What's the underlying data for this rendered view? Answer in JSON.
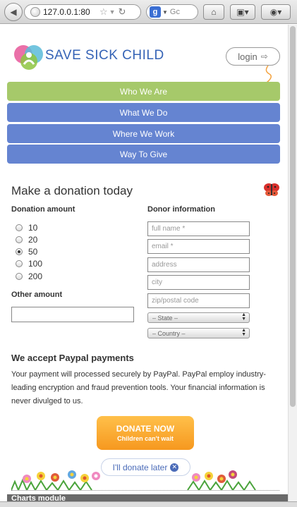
{
  "browser": {
    "url": "127.0.0.1:80",
    "search_text": "Gc",
    "search_engine_letter": "g"
  },
  "header": {
    "logo_text": "SAVE SICK CHILD",
    "login_label": "login"
  },
  "nav": {
    "items": [
      {
        "label": "Who We Are"
      },
      {
        "label": "What We Do"
      },
      {
        "label": "Where We Work"
      },
      {
        "label": "Way To Give"
      }
    ],
    "colors": {
      "active": "#a6c96a",
      "default": "#6584d1"
    }
  },
  "donation": {
    "title": "Make a donation today",
    "amount_label": "Donation amount",
    "amounts": [
      "10",
      "20",
      "50",
      "100",
      "200"
    ],
    "selected_amount": "50",
    "other_amount_label": "Other amount",
    "donor_label": "Donor information",
    "fields": {
      "full_name": "full name *",
      "email": "email *",
      "address": "address",
      "city": "city",
      "zip": "zip/postal code"
    },
    "state_select": "– State –",
    "country_select": "– Country –"
  },
  "paypal": {
    "heading": "We accept Paypal payments",
    "text": "Your payment will processed securely by PayPal. PayPal employ industry-leading encryption and fraud prevention tools. Your financial information is never divulged to us."
  },
  "cta": {
    "donate_label": "DONATE NOW",
    "donate_sub": "Children can't wait",
    "later_label": "I'll donate later",
    "button_color": "#f6981f"
  },
  "footer": {
    "module_title": "Charts module"
  }
}
